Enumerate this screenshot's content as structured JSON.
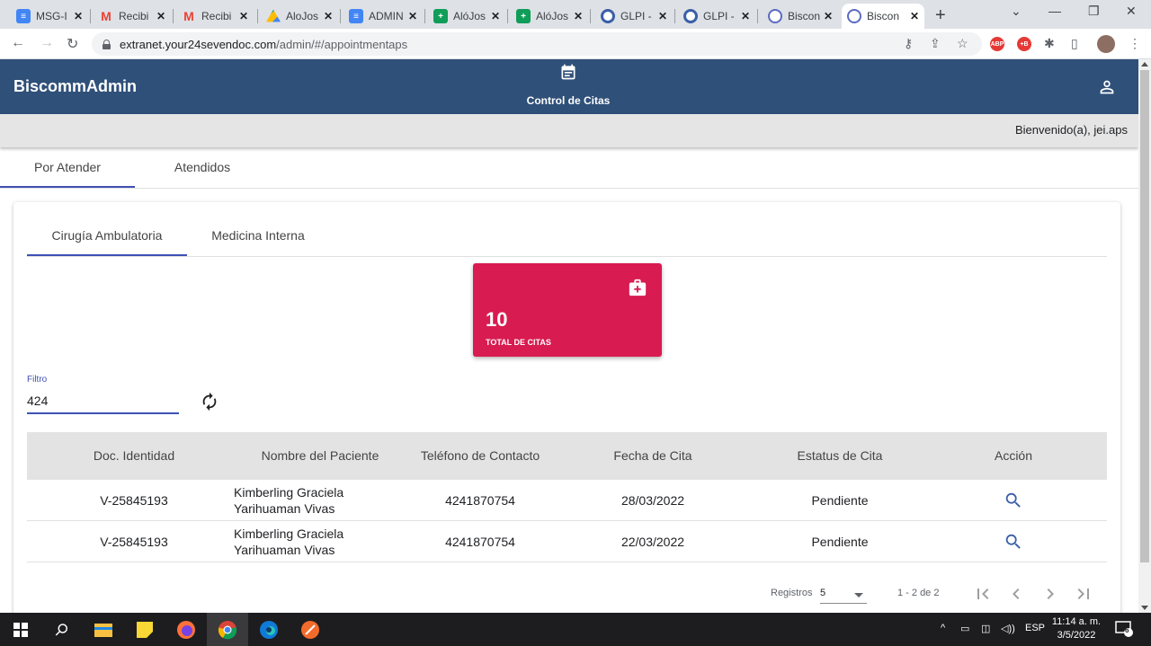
{
  "browser": {
    "tabs": [
      {
        "title": "MSG-I",
        "icon": "docs-icon",
        "color": "#4285f4"
      },
      {
        "title": "Recibi",
        "icon": "gmail-icon",
        "color": "#ea4335"
      },
      {
        "title": "Recibi",
        "icon": "gmail-icon",
        "color": "#ea4335"
      },
      {
        "title": "AloJos",
        "icon": "drive-icon",
        "color": "#fbbc04"
      },
      {
        "title": "ADMIN",
        "icon": "docs-icon",
        "color": "#4285f4"
      },
      {
        "title": "AlóJos",
        "icon": "sheets-icon",
        "color": "#0f9d58"
      },
      {
        "title": "AlóJos",
        "icon": "sheets-icon",
        "color": "#0f9d58"
      },
      {
        "title": "GLPI -",
        "icon": "glpi-icon",
        "color": "#3a5fa8"
      },
      {
        "title": "GLPI -",
        "icon": "glpi-icon",
        "color": "#3a5fa8"
      },
      {
        "title": "Biscon",
        "icon": "biscomm-icon",
        "color": "#5c6bc0"
      },
      {
        "title": "Biscon",
        "icon": "biscomm-icon",
        "color": "#5c6bc0"
      }
    ],
    "url_host": "extranet.your24sevendoc.com",
    "url_path": "/admin/#/appointmentaps",
    "extensions": [
      {
        "label": "ABP",
        "color": "#e53935"
      },
      {
        "label": "+B",
        "color": "#e53935"
      }
    ]
  },
  "app": {
    "brand": "BiscommAdmin",
    "header_title": "Control de Citas",
    "welcome": "Bienvenido(a), jei.aps",
    "main_tabs": [
      {
        "label": "Por Atender",
        "active": true
      },
      {
        "label": "Atendidos",
        "active": false
      }
    ],
    "sub_tabs": [
      {
        "label": "Cirugía Ambulatoria",
        "active": true
      },
      {
        "label": "Medicina Interna",
        "active": false
      }
    ],
    "stat": {
      "value": "10",
      "label": "TOTAL DE CITAS",
      "color": "#d81b50"
    },
    "filter": {
      "label": "Filtro",
      "value": "424"
    },
    "table": {
      "headers": [
        "Doc. Identidad",
        "Nombre del Paciente",
        "Teléfono de Contacto",
        "Fecha de Cita",
        "Estatus de Cita",
        "Acción"
      ],
      "rows": [
        {
          "doc": "V-25845193",
          "name_line1": "Kimberling Graciela",
          "name_line2": "Yarihuaman Vivas",
          "phone": "4241870754",
          "date": "28/03/2022",
          "status": "Pendiente",
          "action_icon": "search-icon"
        },
        {
          "doc": "V-25845193",
          "name_line1": "Kimberling Graciela",
          "name_line2": "Yarihuaman Vivas",
          "phone": "4241870754",
          "date": "22/03/2022",
          "status": "Pendiente",
          "action_icon": "search-icon"
        }
      ]
    },
    "paginator": {
      "label": "Registros",
      "page_size": "5",
      "range": "1 - 2 de 2"
    },
    "accent_color": "#3f51b5",
    "header_color": "#2f5079"
  },
  "taskbar": {
    "tray_lang": "ESP",
    "time": "11:14 a. m.",
    "date": "3/5/2022",
    "notifications": "6"
  }
}
